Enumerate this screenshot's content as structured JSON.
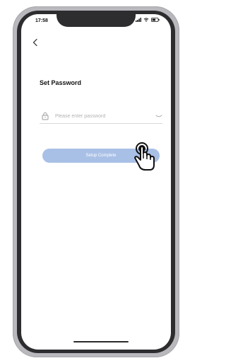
{
  "status_bar": {
    "time": "17:58",
    "icons": [
      "signal-icon",
      "wifi-icon",
      "battery-icon"
    ]
  },
  "navigation": {
    "back_icon": "chevron-left-icon"
  },
  "main": {
    "title": "Set Password",
    "password_field": {
      "placeholder": "Please enter password",
      "value": "",
      "leading_icon": "lock-icon",
      "trailing_icon": "eye-closed-icon"
    },
    "setup_button": {
      "label": "Setup Complete",
      "color": "#a9c0e6"
    },
    "pointer_icon": "hand-pointer-icon"
  },
  "colors": {
    "accent": "#a9c0e6",
    "frame_dark": "#2d2d2f",
    "frame_light": "#b9b9bd"
  }
}
